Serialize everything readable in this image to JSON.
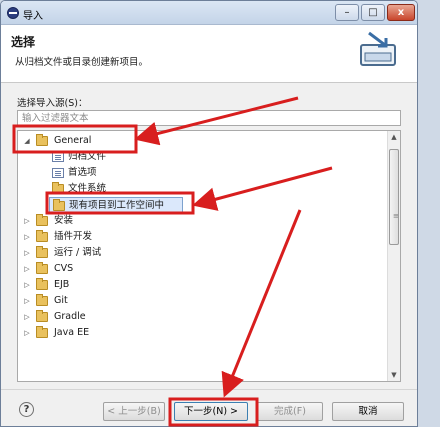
{
  "window": {
    "title": "导入"
  },
  "header": {
    "title": "选择",
    "description": "从归档文件或目录创建新项目。",
    "icon": "import-wizard-icon"
  },
  "source": {
    "label": "选择导入源(S)：",
    "filter_placeholder": "输入过滤器文本",
    "tree": [
      {
        "label": "General",
        "depth": 0,
        "expanded": true,
        "icon": "folder-open-icon"
      },
      {
        "label": "归档文件",
        "depth": 1,
        "icon": "archive-icon"
      },
      {
        "label": "首选项",
        "depth": 1,
        "icon": "preferences-icon"
      },
      {
        "label": "文件系统",
        "depth": 1,
        "icon": "folder-icon"
      },
      {
        "label": "现有项目到工作空间中",
        "depth": 1,
        "selected": true,
        "icon": "project-folder-icon"
      },
      {
        "label": "安装",
        "depth": 0,
        "expanded": false,
        "icon": "folder-icon"
      },
      {
        "label": "插件开发",
        "depth": 0,
        "expanded": false,
        "icon": "folder-icon"
      },
      {
        "label": "运行 / 调试",
        "depth": 0,
        "expanded": false,
        "icon": "folder-icon"
      },
      {
        "label": "CVS",
        "depth": 0,
        "expanded": false,
        "icon": "folder-icon"
      },
      {
        "label": "EJB",
        "depth": 0,
        "expanded": false,
        "icon": "folder-icon"
      },
      {
        "label": "Git",
        "depth": 0,
        "expanded": false,
        "icon": "folder-icon"
      },
      {
        "label": "Gradle",
        "depth": 0,
        "expanded": false,
        "icon": "folder-icon"
      },
      {
        "label": "Java EE",
        "depth": 0,
        "expanded": false,
        "icon": "folder-icon"
      }
    ]
  },
  "footer": {
    "help_icon": "?",
    "back_label": "< 上一步(B)",
    "next_label": "下一步(N) >",
    "finish_label": "完成(F)",
    "cancel_label": "取消"
  },
  "window_controls": {
    "minimize": "–",
    "maximize": "□",
    "close": "x"
  },
  "colors": {
    "annotation_red": "#d81e1e",
    "selection": "#dbe8fb",
    "accent_border": "#3c7fb1"
  }
}
